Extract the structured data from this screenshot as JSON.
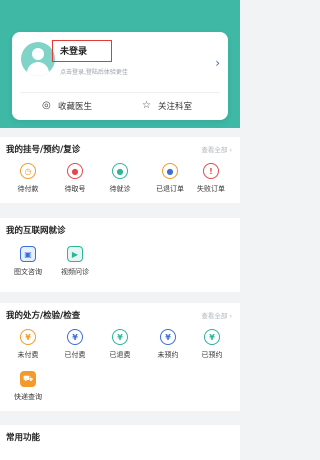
{
  "profile": {
    "name": "未登录",
    "hint": "点击登录,登陆后体验更佳",
    "favorite_doctor": "收藏医生",
    "follow_department": "关注科室"
  },
  "registration": {
    "title": "我的挂号/预约/复诊",
    "view_all": "查看全部",
    "items": [
      {
        "label": "待付款"
      },
      {
        "label": "待取号"
      },
      {
        "label": "待就诊"
      },
      {
        "label": "已退订单"
      },
      {
        "label": "失败订单"
      }
    ]
  },
  "online": {
    "title": "我的互联网就诊",
    "items": [
      {
        "label": "图文咨询"
      },
      {
        "label": "视频问诊"
      }
    ]
  },
  "prescriptions": {
    "title": "我的处方/检验/检查",
    "view_all": "查看全部",
    "items": [
      {
        "label": "未付费"
      },
      {
        "label": "已付费"
      },
      {
        "label": "已退费"
      },
      {
        "label": "未预约"
      },
      {
        "label": "已预约"
      },
      {
        "label": "快递查询"
      }
    ]
  },
  "common": {
    "title": "常用功能"
  },
  "colors": {
    "accent": "#3fb8a6",
    "orange": "#f39a2b",
    "blue": "#3b6fd6",
    "green": "#2bb59a",
    "red": "#e5484d"
  }
}
